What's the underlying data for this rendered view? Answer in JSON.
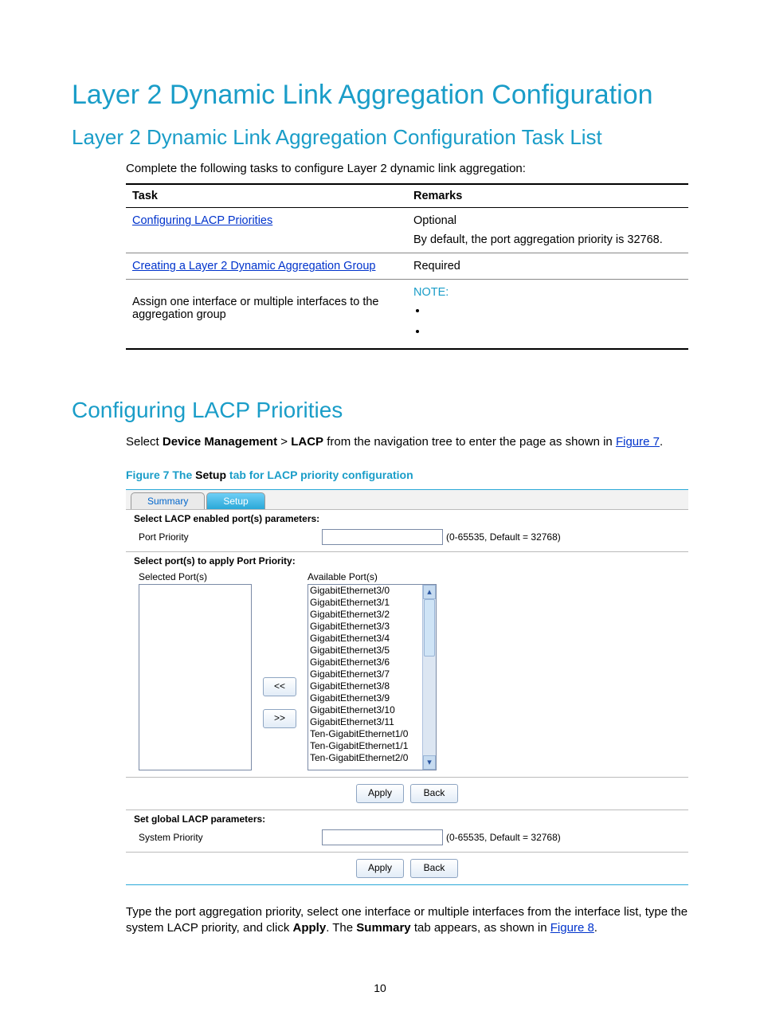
{
  "title": "Layer 2 Dynamic Link Aggregation Configuration",
  "subtitle": "Layer 2 Dynamic Link Aggregation Configuration Task List",
  "intro": "Complete the following tasks to configure Layer 2 dynamic link aggregation:",
  "table": {
    "headers": {
      "task": "Task",
      "remarks": "Remarks"
    },
    "rows": [
      {
        "task_link": "Configuring LACP Priorities",
        "remarks_line1": "Optional",
        "remarks_line2": "By default, the port aggregation priority is 32768."
      },
      {
        "task_link": "Creating a Layer 2 Dynamic Aggregation Group",
        "remarks_line1": "Required"
      },
      {
        "task_text": "Assign one interface or multiple interfaces to the aggregation group",
        "remarks_note": "NOTE:",
        "bullets": [
          "",
          ""
        ]
      }
    ]
  },
  "section2_title": "Configuring LACP Priorities",
  "section2_text": {
    "prefix": "Select ",
    "bold1": "Device Management",
    "sep": " > ",
    "bold2": "LACP",
    "suffix": " from the navigation tree to enter the page as shown in ",
    "link": "Figure 7",
    "end": "."
  },
  "figure_caption": {
    "pre": "Figure 7 The ",
    "bold": "Setup",
    "post": " tab for LACP priority configuration"
  },
  "fig": {
    "tabs": {
      "summary": "Summary",
      "setup": "Setup"
    },
    "sel_params_header": "Select LACP enabled port(s) parameters:",
    "port_priority_label": "Port Priority",
    "port_priority_hint": "(0-65535, Default = 32768)",
    "sel_ports_header": "Select port(s) to apply Port Priority:",
    "selected_label": "Selected Port(s)",
    "available_label": "Available Port(s)",
    "move_left": "<<",
    "move_right": ">>",
    "available_ports": [
      "GigabitEthernet3/0",
      "GigabitEthernet3/1",
      "GigabitEthernet3/2",
      "GigabitEthernet3/3",
      "GigabitEthernet3/4",
      "GigabitEthernet3/5",
      "GigabitEthernet3/6",
      "GigabitEthernet3/7",
      "GigabitEthernet3/8",
      "GigabitEthernet3/9",
      "GigabitEthernet3/10",
      "GigabitEthernet3/11",
      "Ten-GigabitEthernet1/0",
      "Ten-GigabitEthernet1/1",
      "Ten-GigabitEthernet2/0"
    ],
    "apply": "Apply",
    "back": "Back",
    "global_header": "Set global LACP parameters:",
    "system_priority_label": "System Priority",
    "system_priority_hint": "(0-65535, Default = 32768)"
  },
  "closing": {
    "p1_prefix": "Type the port aggregation priority, select one interface or multiple interfaces from the interface list, type the system LACP priority, and click ",
    "p1_bold1": "Apply",
    "p1_mid": ". The ",
    "p1_bold2": "Summary",
    "p1_suffix": " tab appears, as shown in ",
    "p1_link": "Figure 8",
    "p1_end": "."
  },
  "page_number": "10"
}
